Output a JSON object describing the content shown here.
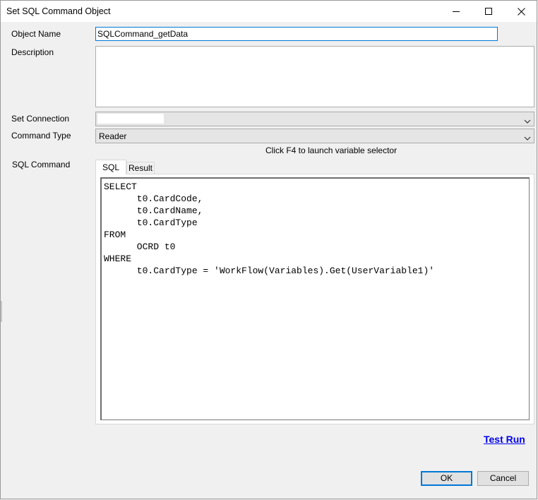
{
  "window": {
    "title": "Set SQL Command Object",
    "minimize_icon": "minimize-icon",
    "maximize_icon": "maximize-icon",
    "close_icon": "close-icon"
  },
  "form": {
    "object_name_label": "Object Name",
    "object_name_value": "SQLCommand_getData",
    "description_label": "Description",
    "description_value": "",
    "set_connection_label": "Set Connection",
    "set_connection_value": "",
    "command_type_label": "Command Type",
    "command_type_value": "Reader",
    "hint": "Click F4 to launch variable selector",
    "sql_command_label": "SQL Command"
  },
  "tabs": [
    {
      "label": "SQL",
      "active": true
    },
    {
      "label": "Result",
      "active": false
    }
  ],
  "sql_lines": [
    "SELECT",
    "      t0.CardCode,",
    "      t0.CardName,",
    "      t0.CardType",
    "FROM",
    "      OCRD t0",
    "WHERE",
    "      t0.CardType = 'WorkFlow(Variables).Get(UserVariable1)'"
  ],
  "actions": {
    "test_run": "Test Run",
    "ok": "OK",
    "cancel": "Cancel"
  },
  "colors": {
    "focus_border": "#0078d7",
    "link": "#0000ee"
  }
}
